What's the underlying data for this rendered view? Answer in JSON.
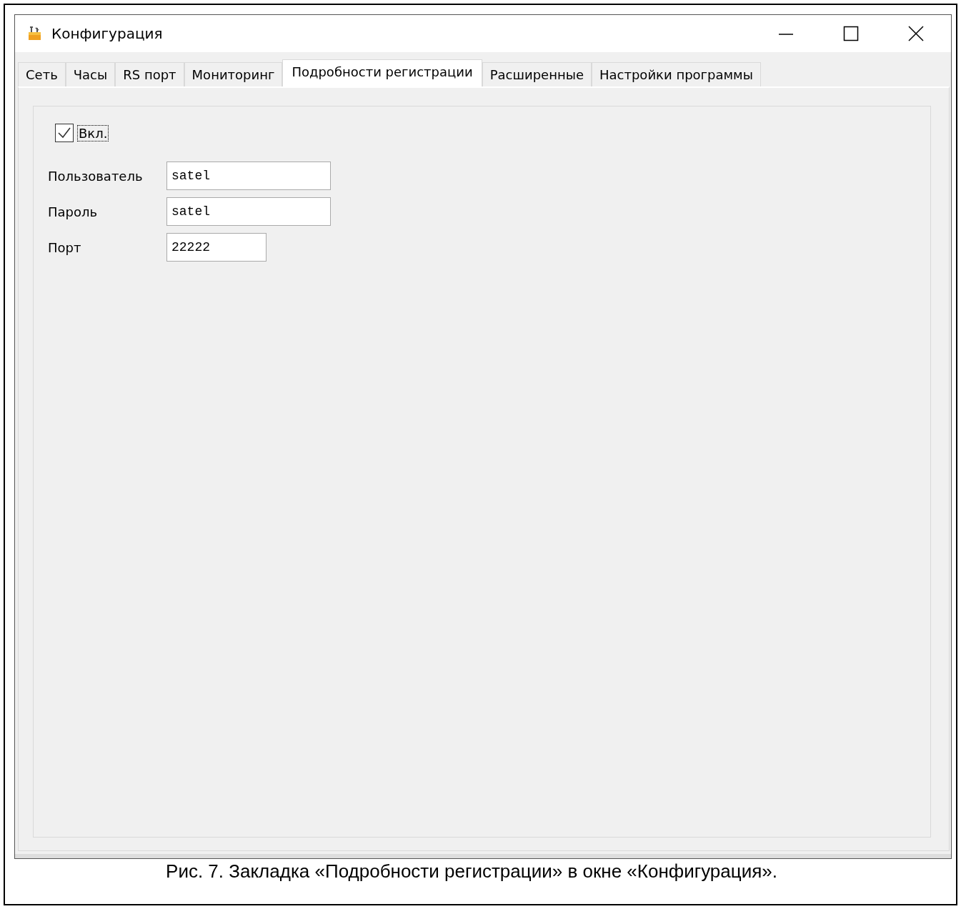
{
  "window": {
    "title": "Конфигурация"
  },
  "tabs": [
    {
      "label": "Сеть",
      "selected": false
    },
    {
      "label": "Часы",
      "selected": false
    },
    {
      "label": "RS порт",
      "selected": false
    },
    {
      "label": "Мониторинг",
      "selected": false
    },
    {
      "label": "Подробности регистрации",
      "selected": true
    },
    {
      "label": "Расширенные",
      "selected": false
    },
    {
      "label": "Настройки программы",
      "selected": false
    }
  ],
  "enable": {
    "label": "Вкл.",
    "checked": true
  },
  "fields": [
    {
      "kind": "wide",
      "label": "Пользователь",
      "value": "satel"
    },
    {
      "kind": "wide",
      "label": "Пароль",
      "value": "satel"
    },
    {
      "kind": "narrow",
      "label": "Порт",
      "value": "22222"
    }
  ],
  "caption": "Рис. 7. Закладка «Подробности регистрации» в окне «Конфигурация»."
}
